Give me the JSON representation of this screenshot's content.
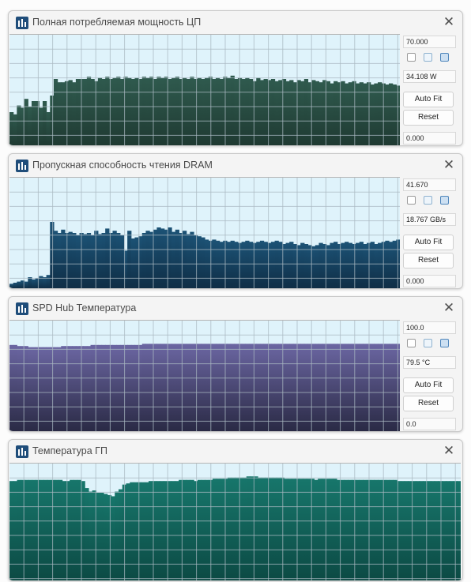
{
  "windows": [
    {
      "title": "Полная потребляемая мощность ЦП",
      "max_value": "70.000",
      "current_value": "34.108 W",
      "min_value": "0.000",
      "auto_fit_label": "Auto Fit",
      "reset_label": "Reset",
      "bg_color": "#dff3fb",
      "fill_color": "#1f3a32",
      "fill_color_top": "#2f5a4e",
      "grid_color": "#aab9c2",
      "levels": [
        0.3,
        0.28,
        0.36,
        0.34,
        0.42,
        0.35,
        0.4,
        0.4,
        0.34,
        0.4,
        0.3,
        0.45,
        0.6,
        0.57,
        0.57,
        0.58,
        0.59,
        0.57,
        0.6,
        0.6,
        0.6,
        0.62,
        0.6,
        0.58,
        0.61,
        0.6,
        0.62,
        0.6,
        0.61,
        0.62,
        0.6,
        0.62,
        0.61,
        0.6,
        0.61,
        0.6,
        0.62,
        0.61,
        0.62,
        0.6,
        0.62,
        0.61,
        0.62,
        0.6,
        0.61,
        0.62,
        0.6,
        0.61,
        0.6,
        0.62,
        0.6,
        0.61,
        0.6,
        0.61,
        0.62,
        0.6,
        0.61,
        0.6,
        0.62,
        0.61,
        0.63,
        0.6,
        0.61,
        0.6,
        0.61,
        0.6,
        0.58,
        0.61,
        0.59,
        0.6,
        0.59,
        0.6,
        0.58,
        0.59,
        0.6,
        0.58,
        0.59,
        0.57,
        0.59,
        0.58,
        0.6,
        0.57,
        0.59,
        0.58,
        0.57,
        0.59,
        0.58,
        0.56,
        0.58,
        0.57,
        0.58,
        0.56,
        0.57,
        0.58,
        0.56,
        0.57,
        0.56,
        0.57,
        0.55,
        0.56,
        0.57,
        0.56,
        0.55,
        0.56,
        0.55,
        0.54
      ]
    },
    {
      "title": "Пропускная способность чтения DRAM",
      "max_value": "41.670",
      "current_value": "18.767 GB/s",
      "min_value": "0.000",
      "auto_fit_label": "Auto Fit",
      "reset_label": "Reset",
      "bg_color": "#dff3fb",
      "fill_color": "#0f2e46",
      "fill_color_top": "#1c5275",
      "grid_color": "#aab9c2",
      "levels": [
        0.04,
        0.05,
        0.06,
        0.07,
        0.06,
        0.1,
        0.08,
        0.09,
        0.11,
        0.1,
        0.12,
        0.6,
        0.52,
        0.5,
        0.53,
        0.5,
        0.51,
        0.5,
        0.48,
        0.5,
        0.49,
        0.5,
        0.48,
        0.52,
        0.49,
        0.5,
        0.54,
        0.5,
        0.52,
        0.5,
        0.48,
        0.34,
        0.52,
        0.45,
        0.46,
        0.47,
        0.5,
        0.52,
        0.51,
        0.53,
        0.55,
        0.54,
        0.53,
        0.55,
        0.51,
        0.53,
        0.5,
        0.52,
        0.49,
        0.51,
        0.48,
        0.47,
        0.46,
        0.44,
        0.43,
        0.44,
        0.43,
        0.42,
        0.43,
        0.42,
        0.43,
        0.42,
        0.41,
        0.42,
        0.43,
        0.42,
        0.41,
        0.42,
        0.43,
        0.42,
        0.41,
        0.42,
        0.43,
        0.42,
        0.4,
        0.41,
        0.42,
        0.4,
        0.39,
        0.41,
        0.4,
        0.39,
        0.38,
        0.39,
        0.41,
        0.4,
        0.39,
        0.41,
        0.42,
        0.4,
        0.41,
        0.42,
        0.41,
        0.4,
        0.41,
        0.42,
        0.4,
        0.41,
        0.42,
        0.4,
        0.41,
        0.42,
        0.43,
        0.42,
        0.43,
        0.44
      ]
    },
    {
      "title": "SPD Hub Температура",
      "max_value": "100.0",
      "current_value": "79.5 °C",
      "min_value": "0.0",
      "auto_fit_label": "Auto Fit",
      "reset_label": "Reset",
      "bg_color": "#dff3fb",
      "fill_color": "#2a2a45",
      "fill_color_top": "#6b66a2",
      "grid_color": "#aab9c2",
      "levels": [
        0.78,
        0.78,
        0.77,
        0.77,
        0.77,
        0.76,
        0.76,
        0.76,
        0.76,
        0.76,
        0.76,
        0.76,
        0.76,
        0.76,
        0.77,
        0.77,
        0.77,
        0.77,
        0.77,
        0.77,
        0.77,
        0.77,
        0.78,
        0.78,
        0.78,
        0.78,
        0.78,
        0.78,
        0.78,
        0.78,
        0.78,
        0.78,
        0.78,
        0.78,
        0.78,
        0.78,
        0.79,
        0.79,
        0.79,
        0.79,
        0.79,
        0.79,
        0.79,
        0.79,
        0.79,
        0.79,
        0.79,
        0.79,
        0.79,
        0.79,
        0.79,
        0.79,
        0.79,
        0.79,
        0.79,
        0.79,
        0.79,
        0.79,
        0.79,
        0.79,
        0.79,
        0.79,
        0.79,
        0.79,
        0.79,
        0.79,
        0.79,
        0.79,
        0.79,
        0.79,
        0.79,
        0.79,
        0.79,
        0.79,
        0.79,
        0.79,
        0.79,
        0.79,
        0.79,
        0.79,
        0.79,
        0.79,
        0.79,
        0.79,
        0.79,
        0.79,
        0.79,
        0.79,
        0.79,
        0.79,
        0.79,
        0.79,
        0.79,
        0.79,
        0.79,
        0.79,
        0.79,
        0.79,
        0.79,
        0.79,
        0.79,
        0.79,
        0.79,
        0.79,
        0.79,
        0.79
      ]
    },
    {
      "title": "Температура ГП",
      "bg_color": "#dff3fb",
      "fill_color": "#0c4a44",
      "fill_color_top": "#17766b",
      "grid_color": "#aab9c2",
      "levels": [
        0.85,
        0.85,
        0.86,
        0.86,
        0.86,
        0.86,
        0.86,
        0.86,
        0.86,
        0.86,
        0.86,
        0.86,
        0.86,
        0.86,
        0.85,
        0.85,
        0.86,
        0.86,
        0.86,
        0.85,
        0.79,
        0.76,
        0.77,
        0.75,
        0.75,
        0.74,
        0.73,
        0.72,
        0.76,
        0.78,
        0.82,
        0.83,
        0.84,
        0.84,
        0.84,
        0.84,
        0.84,
        0.85,
        0.85,
        0.85,
        0.85,
        0.85,
        0.85,
        0.85,
        0.85,
        0.86,
        0.86,
        0.86,
        0.86,
        0.85,
        0.86,
        0.86,
        0.86,
        0.86,
        0.87,
        0.87,
        0.87,
        0.87,
        0.88,
        0.88,
        0.88,
        0.88,
        0.88,
        0.89,
        0.89,
        0.89,
        0.88,
        0.88,
        0.88,
        0.88,
        0.88,
        0.88,
        0.88,
        0.87,
        0.87,
        0.87,
        0.87,
        0.87,
        0.87,
        0.87,
        0.87,
        0.86,
        0.87,
        0.87,
        0.87,
        0.87,
        0.87,
        0.86,
        0.86,
        0.86,
        0.86,
        0.86,
        0.86,
        0.86,
        0.86,
        0.86,
        0.86,
        0.86,
        0.86,
        0.86,
        0.86,
        0.86,
        0.86,
        0.85,
        0.85,
        0.85,
        0.85,
        0.85,
        0.85,
        0.85,
        0.85,
        0.85,
        0.85,
        0.85,
        0.85,
        0.85,
        0.85,
        0.85,
        0.85,
        0.85
      ]
    }
  ]
}
